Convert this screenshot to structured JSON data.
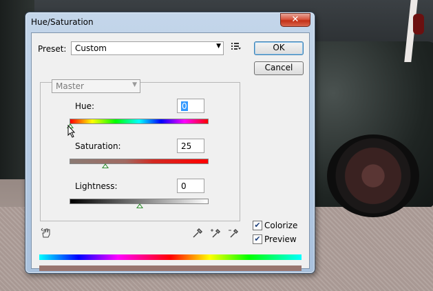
{
  "window": {
    "title": "Hue/Saturation",
    "close_glyph": "✕"
  },
  "preset": {
    "label": "Preset:",
    "value": "Custom",
    "menu_icon": "preset-options-icon"
  },
  "buttons": {
    "ok": "OK",
    "cancel": "Cancel"
  },
  "channel": {
    "value": "Master"
  },
  "hue": {
    "label": "Hue:",
    "value": "0",
    "slider_position": 0.0
  },
  "saturation": {
    "label": "Saturation:",
    "value": "25",
    "slider_position": 0.25
  },
  "lightness": {
    "label": "Lightness:",
    "value": "0",
    "slider_position": 0.5
  },
  "options": {
    "colorize": {
      "label": "Colorize",
      "checked": true
    },
    "preview": {
      "label": "Preview",
      "checked": true
    }
  },
  "colors": {
    "result_bar": "#98756f",
    "accent": "#3399ff"
  },
  "icons": [
    "hand-adjust-icon",
    "eyedropper-icon",
    "eyedropper-plus-icon",
    "eyedropper-minus-icon"
  ]
}
